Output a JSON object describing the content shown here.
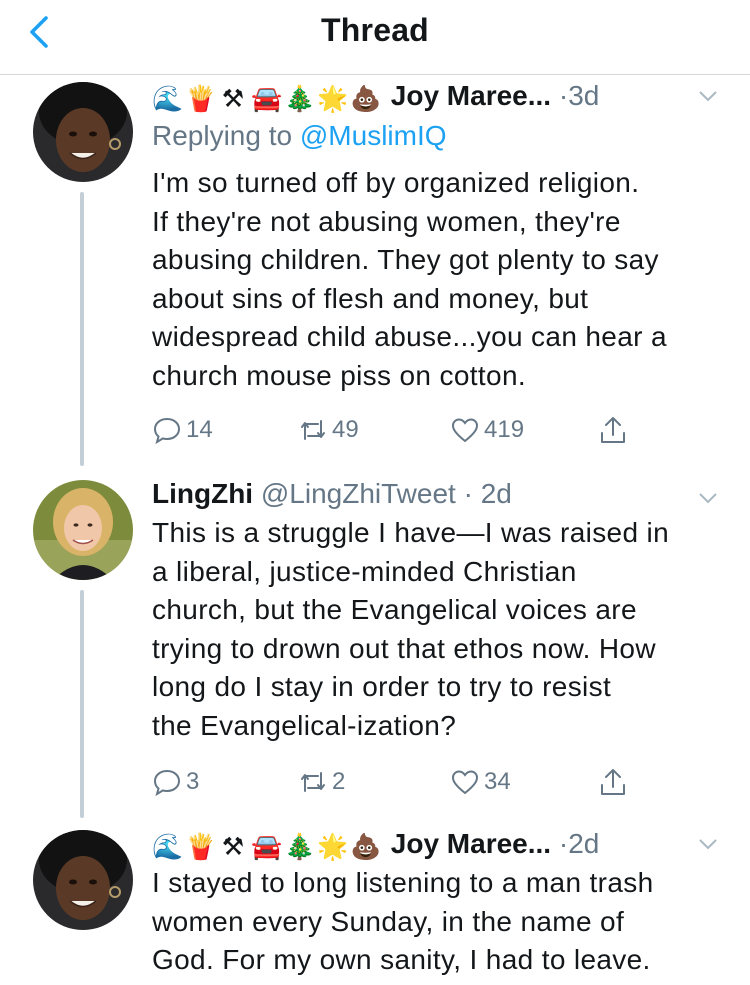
{
  "header": {
    "title": "Thread"
  },
  "colors": {
    "accent": "#1da1f2",
    "secondary_text": "#657786",
    "thread_line": "#c4ced6"
  },
  "tweets": [
    {
      "emojis": [
        "🌊",
        "🍟",
        "⚒",
        "🚘",
        "🎄",
        "🌟",
        "💩"
      ],
      "name": "Joy Maree...",
      "handle": "",
      "time": "3d",
      "replying_to": {
        "prefix": "Replying to ",
        "mention": "@MuslimIQ"
      },
      "text": "I'm so turned off by organized religion.\nIf they're not abusing women, they're\nabusing children. They got plenty to say\nabout sins of flesh and money, but\nwidespread child abuse...you can hear a\nchurch mouse piss on cotton.",
      "replies": "14",
      "retweets": "49",
      "likes": "419"
    },
    {
      "emojis": [],
      "name": "LingZhi",
      "handle": "@LingZhiTweet",
      "time": "2d",
      "text": "This is a struggle I have—I was raised in\na liberal, justice-minded Christian\nchurch, but the Evangelical voices are\ntrying to drown out that ethos now. How\nlong do I stay in order to try to resist\nthe Evangelical-ization?",
      "replies": "3",
      "retweets": "2",
      "likes": "34"
    },
    {
      "emojis": [
        "🌊",
        "🍟",
        "⚒",
        "🚘",
        "🎄",
        "🌟",
        "💩"
      ],
      "name": "Joy Maree...",
      "handle": "",
      "time": "2d",
      "text": "I stayed to long listening to a man trash\nwomen every Sunday, in the name of\nGod. For my own sanity, I had to leave."
    }
  ]
}
